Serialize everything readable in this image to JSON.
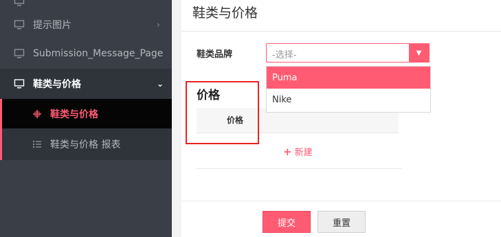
{
  "sidebar": {
    "items": [
      {
        "label": ""
      },
      {
        "label": "提示图片"
      },
      {
        "label": "Submission_Message_Page"
      },
      {
        "label": "鞋类与价格"
      }
    ],
    "subitems": [
      {
        "label": "鞋类与价格"
      },
      {
        "label": "鞋类与价格 报表"
      }
    ]
  },
  "main": {
    "title": "鞋类与价格",
    "brand_label": "鞋类品牌",
    "select_placeholder": "-选择-",
    "dropdown_options": [
      "Puma",
      "Nike"
    ],
    "section_title": "价格",
    "table_header_price": "价格",
    "add_new": "新建",
    "submit": "提交",
    "reset": "重置"
  },
  "colors": {
    "accent": "#ff5b73",
    "sidebar_bg": "#3a3f47",
    "highlight": "#e8231f"
  }
}
